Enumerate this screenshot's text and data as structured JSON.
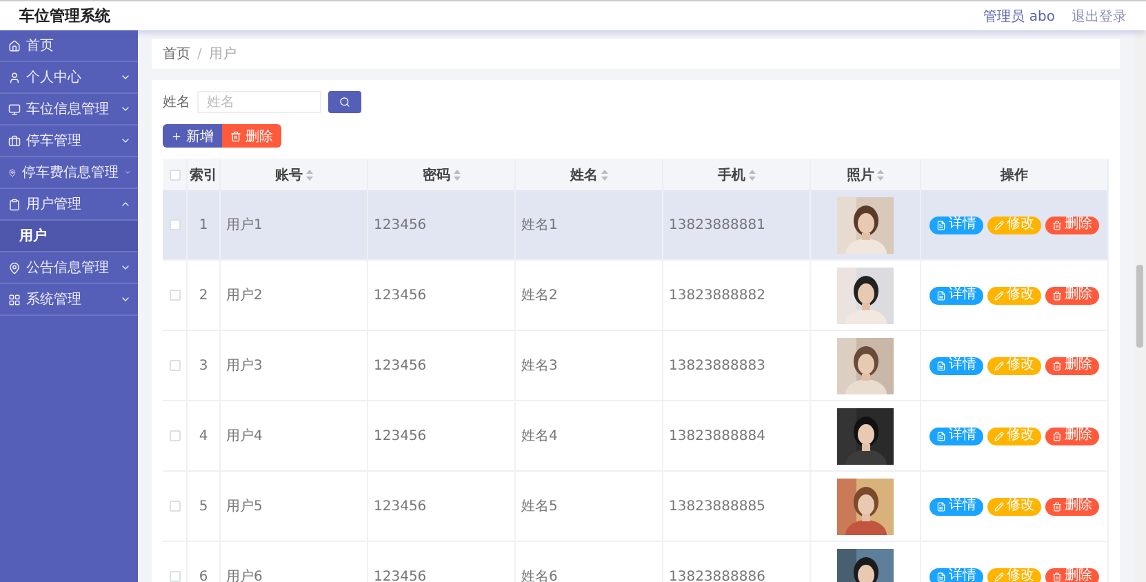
{
  "app_title": "车位管理系统",
  "header_links": [
    {
      "label": "管理员 abo",
      "kind": "user"
    },
    {
      "label": "退出登录",
      "kind": "link"
    }
  ],
  "sidebar": {
    "items": [
      {
        "label": "首页"
      },
      {
        "label": "个人中心",
        "expanded": false
      },
      {
        "label": "车位信息管理",
        "expanded": false
      },
      {
        "label": "停车管理",
        "expanded": false
      },
      {
        "label": "停车费信息管理",
        "expanded": false
      },
      {
        "label": "用户管理",
        "expanded": true,
        "children": [
          {
            "label": "用户",
            "selected": true
          }
        ]
      },
      {
        "label": "公告信息管理",
        "expanded": false
      },
      {
        "label": "系统管理",
        "expanded": false
      }
    ]
  },
  "breadcrumb": {
    "items": [
      "首页",
      "用户"
    ],
    "separator": "/"
  },
  "search": {
    "label": "姓名",
    "placeholder": "姓名"
  },
  "toolbar": [
    {
      "label": "新增",
      "kind": "add"
    },
    {
      "label": "删除",
      "kind": "delete"
    }
  ],
  "table": {
    "all_checked": false,
    "columns": [
      {
        "label": "索引",
        "sortable": false
      },
      {
        "label": "账号",
        "sortable": true
      },
      {
        "label": "密码",
        "sortable": true
      },
      {
        "label": "姓名",
        "sortable": true
      },
      {
        "label": "手机",
        "sortable": true
      },
      {
        "label": "照片",
        "sortable": true
      },
      {
        "label": "操作",
        "sortable": false
      }
    ],
    "rows": [
      {
        "index": "1",
        "account": "用户1",
        "password": "123456",
        "name": "姓名1",
        "phone": "13823888881",
        "highlighted": true,
        "checked": false,
        "actions": [
          {
            "label": "详情",
            "kind": "detail"
          },
          {
            "label": "修改",
            "kind": "edit"
          },
          {
            "label": "删除",
            "kind": "delete"
          }
        ]
      },
      {
        "index": "2",
        "account": "用户2",
        "password": "123456",
        "name": "姓名2",
        "phone": "13823888882",
        "highlighted": false,
        "checked": false,
        "actions": [
          {
            "label": "详情",
            "kind": "detail"
          },
          {
            "label": "修改",
            "kind": "edit"
          },
          {
            "label": "删除",
            "kind": "delete"
          }
        ]
      },
      {
        "index": "3",
        "account": "用户3",
        "password": "123456",
        "name": "姓名3",
        "phone": "13823888883",
        "highlighted": false,
        "checked": false,
        "actions": [
          {
            "label": "详情",
            "kind": "detail"
          },
          {
            "label": "修改",
            "kind": "edit"
          },
          {
            "label": "删除",
            "kind": "delete"
          }
        ]
      },
      {
        "index": "4",
        "account": "用户4",
        "password": "123456",
        "name": "姓名4",
        "phone": "13823888884",
        "highlighted": false,
        "checked": false,
        "actions": [
          {
            "label": "详情",
            "kind": "detail"
          },
          {
            "label": "修改",
            "kind": "edit"
          },
          {
            "label": "删除",
            "kind": "delete"
          }
        ]
      },
      {
        "index": "5",
        "account": "用户5",
        "password": "123456",
        "name": "姓名5",
        "phone": "13823888885",
        "highlighted": false,
        "checked": false,
        "actions": [
          {
            "label": "详情",
            "kind": "detail"
          },
          {
            "label": "修改",
            "kind": "edit"
          },
          {
            "label": "删除",
            "kind": "delete"
          }
        ]
      },
      {
        "index": "6",
        "account": "用户6",
        "password": "123456",
        "name": "姓名6",
        "phone": "13823888886",
        "highlighted": false,
        "checked": false,
        "actions": [
          {
            "label": "详情",
            "kind": "detail"
          },
          {
            "label": "修改",
            "kind": "edit"
          },
          {
            "label": "删除",
            "kind": "delete"
          }
        ]
      }
    ]
  }
}
